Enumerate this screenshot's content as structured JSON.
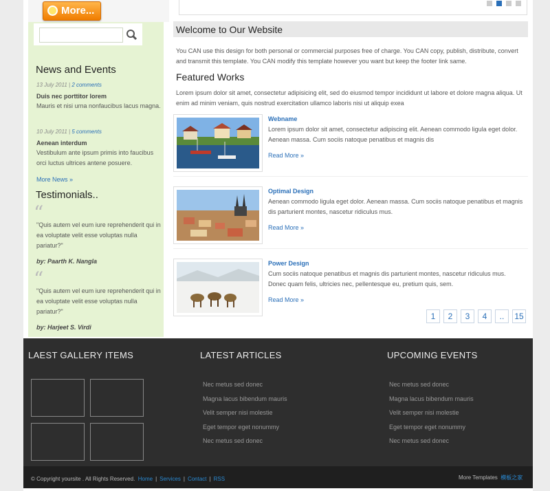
{
  "sidebar": {
    "more_button": "More...",
    "search_placeholder": "",
    "news_heading": "News and Events",
    "news": [
      {
        "date": "13 July 2011",
        "comments": "2 comments",
        "title": "Duis nec porttitor lorem",
        "text": "Mauris et nisi urna nonfaucibus lacus magna."
      },
      {
        "date": "10 July 2011",
        "comments": "5 comments",
        "title": "Aenean interdum",
        "text": "Vestibulum ante ipsum primis into faucibus orci luctus ultrices antene posuere."
      }
    ],
    "more_news": "More News »",
    "testimonials_heading": "Testimonials..",
    "testimonials": [
      {
        "quote": "\"Quis autem vel eum iure reprehenderit qui in ea voluptate velit esse voluptas nulla pariatur?\"",
        "author": "by: Paarth K. Nangla"
      },
      {
        "quote": "\"Quis autem vel eum iure reprehenderit qui in ea voluptate velit esse voluptas nulla pariatur?\"",
        "author": "by: Harjeet S. Virdi"
      }
    ]
  },
  "main": {
    "welcome_title": "Welcome to Our Website",
    "welcome_text": "You CAN use this design for both personal or commercial purposes free of charge. You CAN copy, publish, distribute, convert and transmit this template. You CAN modify this template however you want but keep the footer link same.",
    "featured_title": "Featured Works",
    "featured_text": "Lorem ipsum dolor sit amet, consectetur adipisicing elit, sed do eiusmod tempor incididunt ut labore et dolore magna aliqua. Ut enim ad minim veniam, quis nostrud exercitation ullamco laboris nisi ut aliquip exea",
    "works": [
      {
        "title": "Webname",
        "text": "Lorem ipsum dolor sit amet, consectetur adipiscing elit. Aenean commodo ligula eget dolor. Aenean massa. Cum sociis natoque penatibus et magnis dis",
        "more": "Read More »"
      },
      {
        "title": "Optimal Design",
        "text": "Aenean commodo ligula eget dolor. Aenean massa. Cum sociis natoque penatibus et magnis dis parturient montes, nascetur ridiculus mus.",
        "more": "Read More »"
      },
      {
        "title": "Power Design",
        "text": "Cum sociis natoque penatibus et magnis dis parturient montes, nascetur ridiculus mus. Donec quam felis, ultricies nec, pellentesque eu, pretium quis, sem.",
        "more": "Read More »"
      }
    ],
    "pagination": [
      "1",
      "2",
      "3",
      "4",
      "..",
      "15"
    ]
  },
  "footer": {
    "gallery_heading": "LAEST GALLERY ITEMS",
    "articles_heading": "LATEST ARTICLES",
    "events_heading": "UPCOMING EVENTS",
    "articles": [
      "Nec metus sed donec",
      "Magna lacus bibendum mauris",
      "Velit semper nisi molestie",
      "Eget tempor eget nonummy",
      "Nec metus sed donec"
    ],
    "events": [
      "Nec metus sed donec",
      "Magna lacus bibendum mauris",
      "Velit semper nisi molestie",
      "Eget tempor eget nonummy",
      "Nec metus sed donec"
    ],
    "copyright": "© Copyright yoursite . All Rights Reserved.",
    "links": [
      "Home",
      "Services",
      "Contact",
      "RSS"
    ],
    "more_templates_label": "More Templates",
    "more_templates_link": "模板之家"
  },
  "colors": {
    "accent": "#2a6fb8",
    "sidebar_bg": "#e6f3d3",
    "footer_bg": "#2e2e2e",
    "button": "#f07d00"
  }
}
